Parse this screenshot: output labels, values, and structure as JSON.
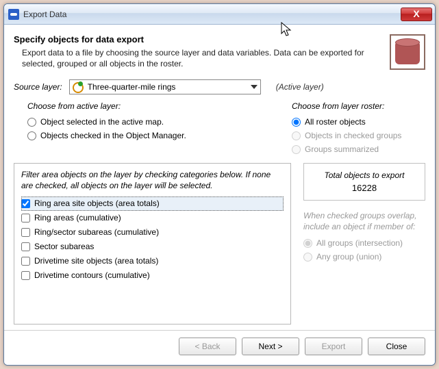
{
  "window": {
    "title": "Export Data",
    "close_label": "X"
  },
  "header": {
    "heading": "Specify objects for data export",
    "description": "Export data to a file by choosing the source layer and data variables. Data can be exported for selected, grouped or all objects in the roster."
  },
  "source": {
    "label": "Source layer:",
    "selected": "Three-quarter-mile rings",
    "active_layer_label": "(Active layer)"
  },
  "active_group": {
    "heading": "Choose from active layer:",
    "opt_selected_map": "Object selected in the active map.",
    "opt_checked_manager": "Objects checked in the Object Manager."
  },
  "roster_group": {
    "heading": "Choose from layer roster:",
    "opt_all": "All roster objects",
    "opt_checked_groups": "Objects in checked groups",
    "opt_groups_summarized": "Groups summarized"
  },
  "filter": {
    "text": "Filter area objects on the layer by checking categories below. If none are checked, all objects on the layer will be selected.",
    "items": [
      {
        "label": "Ring area site objects (area totals)",
        "checked": true
      },
      {
        "label": "Ring areas (cumulative)",
        "checked": false
      },
      {
        "label": "Ring/sector subareas (cumulative)",
        "checked": false
      },
      {
        "label": "Sector subareas",
        "checked": false
      },
      {
        "label": "Drivetime site objects (area totals)",
        "checked": false
      },
      {
        "label": "Drivetime contours (cumulative)",
        "checked": false
      }
    ]
  },
  "export_count": {
    "label": "Total objects to export",
    "value": "16228"
  },
  "overlap": {
    "text": "When checked groups overlap, include an object if member of:",
    "opt_intersection": "All groups (intersection)",
    "opt_union": "Any group (union)"
  },
  "footer": {
    "back": "< Back",
    "next": "Next >",
    "export": "Export",
    "close": "Close"
  }
}
